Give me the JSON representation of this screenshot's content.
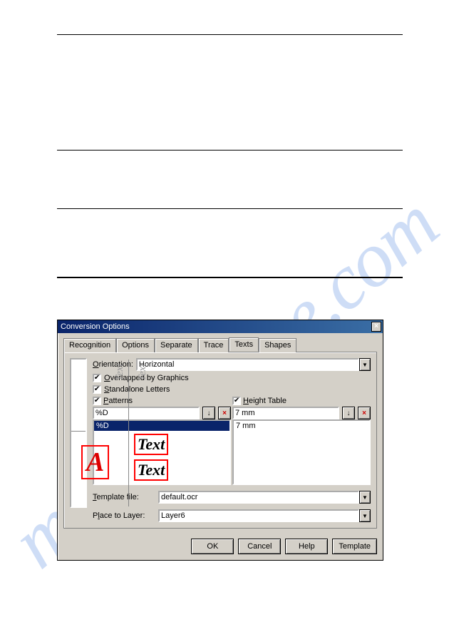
{
  "dialog": {
    "title": "Conversion Options",
    "tabs": [
      "Recognition",
      "Options",
      "Separate",
      "Trace",
      "Texts",
      "Shapes"
    ],
    "active_tab": "Texts",
    "orientation_label": "Orientation:",
    "orientation_value": "Horizontal",
    "overlapped_label": "Overlapped by Graphics",
    "standalone_label": "Standalone Letters",
    "patterns_label": "Patterns",
    "height_table_label": "Height Table",
    "pattern_input": "%D",
    "height_input": "7 mm",
    "pattern_list_item": "%D",
    "height_list_item": "7 mm",
    "template_label": "Template file:",
    "template_value": "default.ocr",
    "layer_label": "Place to Layer:",
    "layer_value": "Layer6",
    "buttons": {
      "ok": "OK",
      "cancel": "Cancel",
      "help": "Help",
      "template": "Template"
    },
    "preview": {
      "vtext": "Text",
      "boxtext": "Text",
      "letter": "A"
    }
  }
}
